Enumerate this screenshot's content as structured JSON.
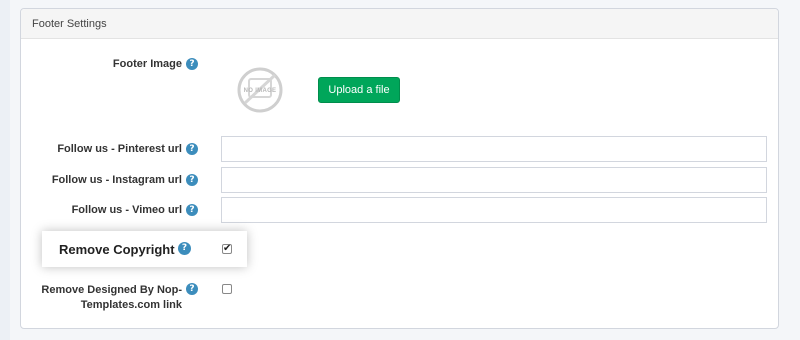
{
  "panel": {
    "title": "Footer Settings"
  },
  "fields": {
    "footer_image": {
      "label": "Footer Image",
      "no_image_text": "NO IMAGE",
      "upload_label": "Upload a file"
    },
    "pinterest": {
      "label": "Follow us - Pinterest url",
      "value": ""
    },
    "instagram": {
      "label": "Follow us - Instagram url",
      "value": ""
    },
    "vimeo": {
      "label": "Follow us - Vimeo url",
      "value": ""
    },
    "remove_copyright": {
      "label": "Remove Copyright",
      "checked": true
    },
    "remove_designed_by": {
      "label_line1": "Remove Designed By Nop-",
      "label_line2": "Templates.com link",
      "checked": false
    }
  },
  "help_icon_glyph": "?",
  "colors": {
    "upload_button": "#00a65a",
    "help_icon": "#3c8dbc"
  }
}
